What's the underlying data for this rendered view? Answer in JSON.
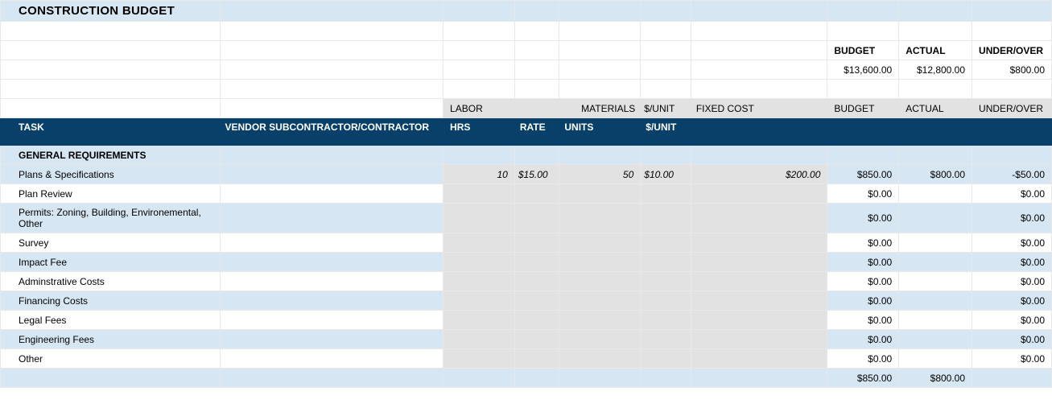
{
  "title": "CONSTRUCTION BUDGET",
  "summary_headers": {
    "budget": "BUDGET",
    "actual": "ACTUAL",
    "under_over": "UNDER/OVER"
  },
  "summary_totals": {
    "budget": "$13,600.00",
    "actual": "$12,800.00",
    "under_over": "$800.00"
  },
  "grey_headers": {
    "labor": "LABOR",
    "materials": "MATERIALS",
    "per_unit": "$/UNIT",
    "fixed_cost": "FIXED COST",
    "budget": "BUDGET",
    "actual": "ACTUAL",
    "under_over": "UNDER/OVER"
  },
  "col_headers": {
    "task": "TASK",
    "vendor": "VENDOR SUBCONTRACTOR/CONTRACTOR",
    "hrs": "HRS",
    "rate": "RATE",
    "units": "UNITS",
    "per_unit": "$/UNIT"
  },
  "section_title": "GENERAL REQUIREMENTS",
  "rows": [
    {
      "task": "Plans & Specifications",
      "hrs": "10",
      "rate": "$15.00",
      "units": "50",
      "punit": "$10.00",
      "fixed": "$200.00",
      "budget": "$850.00",
      "actual": "$800.00",
      "uo": "-$50.00"
    },
    {
      "task": "Plan Review",
      "hrs": "",
      "rate": "",
      "units": "",
      "punit": "",
      "fixed": "",
      "budget": "$0.00",
      "actual": "",
      "uo": "$0.00"
    },
    {
      "task": "Permits: Zoning, Building, Environemental, Other",
      "hrs": "",
      "rate": "",
      "units": "",
      "punit": "",
      "fixed": "",
      "budget": "$0.00",
      "actual": "",
      "uo": "$0.00"
    },
    {
      "task": "Survey",
      "hrs": "",
      "rate": "",
      "units": "",
      "punit": "",
      "fixed": "",
      "budget": "$0.00",
      "actual": "",
      "uo": "$0.00"
    },
    {
      "task": "Impact Fee",
      "hrs": "",
      "rate": "",
      "units": "",
      "punit": "",
      "fixed": "",
      "budget": "$0.00",
      "actual": "",
      "uo": "$0.00"
    },
    {
      "task": "Adminstrative Costs",
      "hrs": "",
      "rate": "",
      "units": "",
      "punit": "",
      "fixed": "",
      "budget": "$0.00",
      "actual": "",
      "uo": "$0.00"
    },
    {
      "task": "Financing Costs",
      "hrs": "",
      "rate": "",
      "units": "",
      "punit": "",
      "fixed": "",
      "budget": "$0.00",
      "actual": "",
      "uo": "$0.00"
    },
    {
      "task": "Legal Fees",
      "hrs": "",
      "rate": "",
      "units": "",
      "punit": "",
      "fixed": "",
      "budget": "$0.00",
      "actual": "",
      "uo": "$0.00"
    },
    {
      "task": "Engineering Fees",
      "hrs": "",
      "rate": "",
      "units": "",
      "punit": "",
      "fixed": "",
      "budget": "$0.00",
      "actual": "",
      "uo": "$0.00"
    },
    {
      "task": "Other",
      "hrs": "",
      "rate": "",
      "units": "",
      "punit": "",
      "fixed": "",
      "budget": "$0.00",
      "actual": "",
      "uo": "$0.00"
    }
  ],
  "subtotals": {
    "budget": "$850.00",
    "actual": "$800.00",
    "uo": ""
  }
}
